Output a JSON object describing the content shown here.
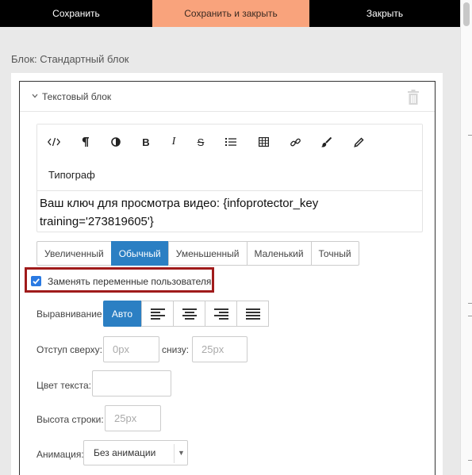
{
  "topbar": {
    "save": "Сохранить",
    "save_close": "Сохранить и закрыть",
    "close": "Закрыть"
  },
  "block_title": "Блок: Стандартный блок",
  "card": {
    "title": "Текстовый блок"
  },
  "editor": {
    "tools": [
      "code-icon",
      "pilcrow-icon",
      "contrast-icon",
      "bold-icon",
      "italic-icon",
      "strikethrough-icon",
      "list-icon",
      "table-icon",
      "link-icon",
      "brush-icon",
      "pencil-icon"
    ],
    "typograph": "Типограф",
    "content_line1": "Ваш ключ для просмотра видео: {infoprotector_key",
    "content_line2": "training='273819605'}"
  },
  "sizes": {
    "options": [
      "Увеличенный",
      "Обычный",
      "Уменьшенный",
      "Маленький",
      "Точный"
    ],
    "selected": "Обычный"
  },
  "replace_vars": {
    "label": "Заменять переменные пользователя",
    "checked": true
  },
  "alignment": {
    "label": "Выравнивание",
    "auto": "Авто",
    "options": [
      "align-left-icon",
      "align-center-icon",
      "align-right-icon",
      "align-justify-icon"
    ]
  },
  "padding": {
    "top_label": "Отступ сверху:",
    "top_placeholder": "0px",
    "bottom_label": "снизу:",
    "bottom_placeholder": "25px"
  },
  "text_color": {
    "label": "Цвет текста:"
  },
  "line_height": {
    "label": "Высота строки:",
    "placeholder": "25px"
  },
  "animation": {
    "label": "Анимация:",
    "value": "Без анимации"
  },
  "colors": {
    "accent": "#2b7fc3",
    "save_close_bg": "#f9a37c",
    "highlight_border": "#a01b1b"
  }
}
